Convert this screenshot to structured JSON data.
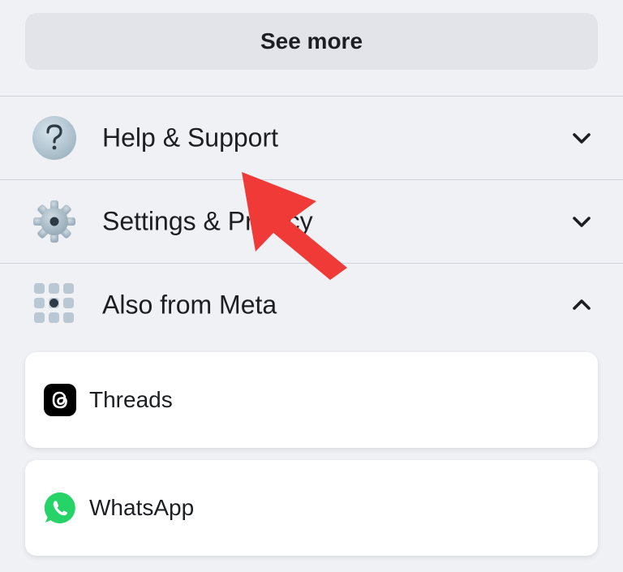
{
  "see_more": {
    "label": "See more"
  },
  "sections": [
    {
      "label": "Help & Support",
      "icon": "question-icon",
      "chevron": "chevron-down-icon"
    },
    {
      "label": "Settings & Privacy",
      "icon": "gear-icon",
      "chevron": "chevron-down-icon"
    },
    {
      "label": "Also from Meta",
      "icon": "meta-grid-icon",
      "chevron": "chevron-up-icon"
    }
  ],
  "apps": [
    {
      "label": "Threads",
      "icon": "threads-icon"
    },
    {
      "label": "WhatsApp",
      "icon": "whatsapp-icon"
    }
  ],
  "colors": {
    "background": "#eff1f5",
    "button_bg": "#e2e4e9",
    "annotation_arrow": "#f03a37",
    "whatsapp_green": "#25d366"
  }
}
